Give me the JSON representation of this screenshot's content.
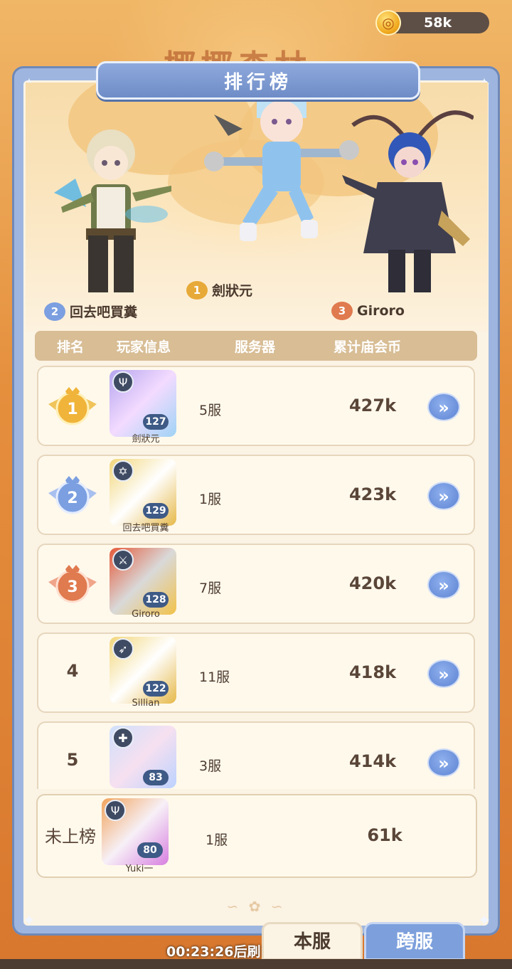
{
  "currency": {
    "value": "58k",
    "icon": "coin-icon"
  },
  "background": {
    "title_partial": "椰椰森林"
  },
  "panel": {
    "title": "排行榜"
  },
  "podium": [
    {
      "rank": "1",
      "name": "劍狀元",
      "color": "#e7a938"
    },
    {
      "rank": "2",
      "name": "回去吧買糞",
      "color": "#7b9fe0"
    },
    {
      "rank": "3",
      "name": "Giroro",
      "color": "#e07a4f"
    }
  ],
  "table": {
    "headers": {
      "rank": "排名",
      "player": "玩家信息",
      "server": "服务器",
      "coins": "累计庙会币"
    },
    "rows": [
      {
        "rank": "1",
        "name": "劍狀元",
        "level": "127",
        "server": "5服",
        "coins": "427k"
      },
      {
        "rank": "2",
        "name": "回去吧買糞",
        "level": "129",
        "server": "1服",
        "coins": "423k"
      },
      {
        "rank": "3",
        "name": "Giroro",
        "level": "128",
        "server": "7服",
        "coins": "420k"
      },
      {
        "rank": "4",
        "name": "Sillian",
        "level": "122",
        "server": "11服",
        "coins": "418k"
      },
      {
        "rank": "5",
        "name": "",
        "level": "83",
        "server": "3服",
        "coins": "414k"
      }
    ],
    "go_glyph": "»"
  },
  "my_entry": {
    "rank": "未上榜",
    "name": "Yuki一",
    "level": "80",
    "server": "1服",
    "coins": "61k"
  },
  "tabs": {
    "local": "本服",
    "cross": "跨服"
  },
  "timer_text": "00:23:26后刷"
}
